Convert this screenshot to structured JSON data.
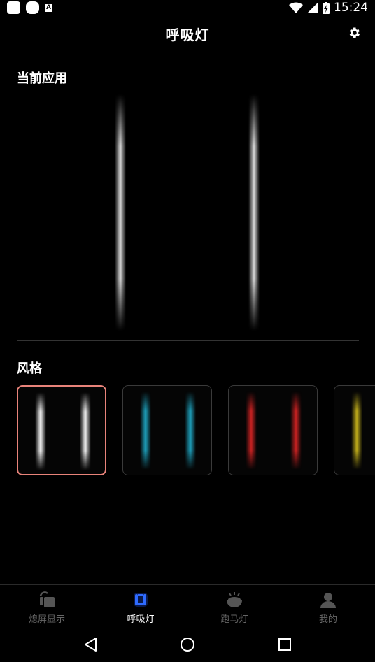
{
  "status_bar": {
    "time": "15:24",
    "notif_letter": "A"
  },
  "app_bar": {
    "title": "呼吸灯"
  },
  "current": {
    "title": "当前应用",
    "glow_color": "#ffffff"
  },
  "styles": {
    "title": "风格",
    "items": [
      {
        "color": "#ffffff",
        "selected": true
      },
      {
        "color": "#1fa7c4",
        "selected": false
      },
      {
        "color": "#d42424",
        "selected": false
      },
      {
        "color": "#c9b51c",
        "selected": false
      }
    ]
  },
  "bottom_nav": {
    "items": [
      {
        "label": "熄屏显示",
        "active": false
      },
      {
        "label": "呼吸灯",
        "active": true
      },
      {
        "label": "跑马灯",
        "active": false
      },
      {
        "label": "我的",
        "active": false
      }
    ]
  },
  "colors": {
    "accent": "#e8837a",
    "nav_active_icon": "#2f6bff",
    "inactive": "#555555"
  }
}
